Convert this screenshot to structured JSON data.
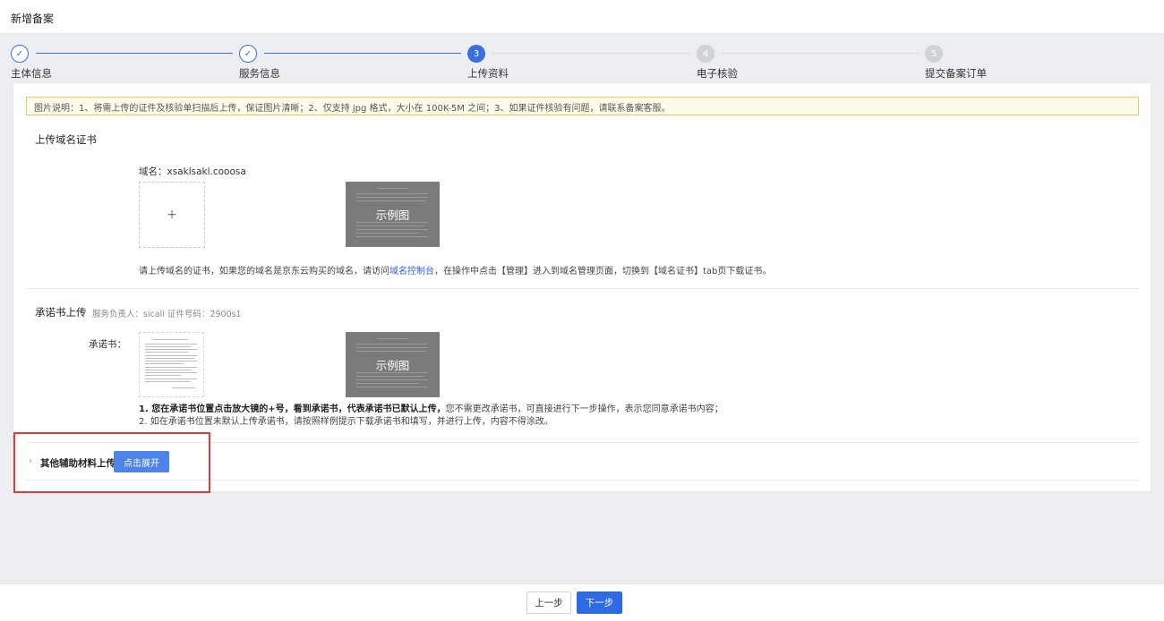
{
  "header": {
    "title": "新增备案"
  },
  "steps": [
    {
      "index": "✓",
      "label": "主体信息",
      "state": "done"
    },
    {
      "index": "✓",
      "label": "服务信息",
      "state": "done"
    },
    {
      "index": "3",
      "label": "上传资料",
      "state": "active"
    },
    {
      "index": "4",
      "label": "电子核验",
      "state": "todo"
    },
    {
      "index": "5",
      "label": "提交备案订单",
      "state": "todo"
    }
  ],
  "notice": "图片说明：1、将需上传的证件及核验单扫描后上传，保证图片清晰；2、仅支持 jpg 格式，大小在 100K-5M 之间；3、如果证件核验有问题，请联系备案客服。",
  "domain_cert": {
    "title": "上传域名证书",
    "domain_label": "域名：xsaklsakl.cooosa",
    "upload_plus": "+",
    "sample_text": "示例图",
    "hint_before": "请上传域名的证书，如果您的域名是京东云购买的域名，请访问",
    "hint_link": "域名控制台",
    "hint_after": "，在操作中点击【管理】进入到域名管理页面，切换到【域名证书】tab页下载证书。"
  },
  "commitment": {
    "title": "承诺书上传",
    "meta": "服务负责人：sicali   证件号码：2900s1",
    "field_label": "承诺书：",
    "sample_text": "示例图",
    "hint1_bold": "1. 您在承诺书位置点击放大镜的+号，看到承诺书，代表承诺书已默认上传，",
    "hint1_rest": "您不需更改承诺书，可直接进行下一步操作，表示您同意承诺书内容；",
    "hint2": "2. 如在承诺书位置未默认上传承诺书，请按照样例提示下载承诺书和填写，并进行上传，内容不得涂改。"
  },
  "other": {
    "chevron": "›",
    "label": "其他辅助材料上传",
    "expand_button": "点击展开"
  },
  "footer": {
    "prev": "上一步",
    "next": "下一步"
  }
}
